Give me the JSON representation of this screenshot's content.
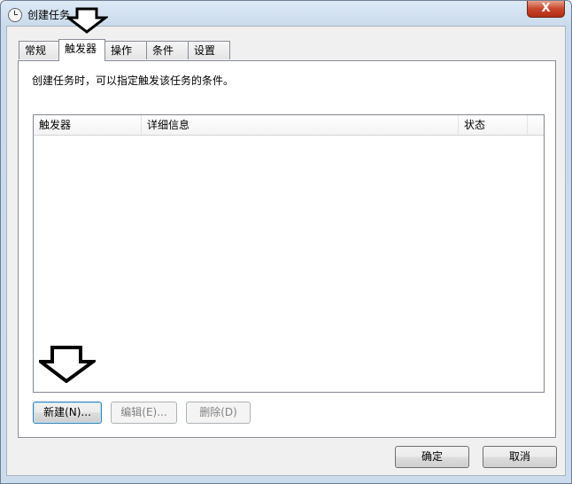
{
  "window": {
    "title": "创建任务",
    "close_label": "X"
  },
  "tabs": [
    {
      "label": "常规"
    },
    {
      "label": "触发器"
    },
    {
      "label": "操作"
    },
    {
      "label": "条件"
    },
    {
      "label": "设置"
    }
  ],
  "active_tab": "触发器",
  "description": "创建任务时，可以指定触发该任务的条件。",
  "table": {
    "columns": [
      "触发器",
      "详细信息",
      "状态"
    ],
    "rows": []
  },
  "buttons": {
    "new": "新建(N)...",
    "edit": "编辑(E)...",
    "delete": "删除(D)",
    "ok": "确定",
    "cancel": "取消"
  },
  "annotations": {
    "arrow_color": "#000000"
  }
}
